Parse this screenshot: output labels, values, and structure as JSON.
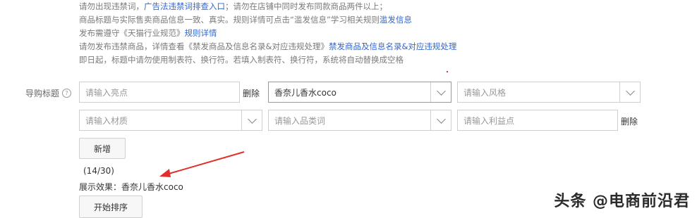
{
  "notes": {
    "line1": {
      "pre": "请勿出现违禁词，",
      "link": "广告法违禁词排查入口",
      "post": "；请勿在店铺中同时发布同款商品两件以上；"
    },
    "line2": {
      "pre": "商品标题与实际售卖商品信息一致、真实。规则详情可点击“滥发信息”学习相关规则",
      "link": "滥发信息"
    },
    "line3": {
      "pre": "发布需遵守《天猫行业规范》",
      "link": "规则详情"
    },
    "line4": {
      "pre": "请勿发布违禁商品，详情查看《禁发商品及信息名录&对应违规处理》",
      "link": "禁发商品及信息名录&对应违规处理"
    },
    "line5": {
      "text": "即日起，标题中请勿使用制表符、换行符。若填入制表符、换行符，系统将自动替换成空格"
    }
  },
  "form": {
    "label": "导购标题",
    "help_icon": "question-circle-icon",
    "fields": {
      "highlight": "请输入亮点",
      "brand_value": "香奈儿香水coco",
      "style": "请输入风格",
      "material": "请输入材质",
      "category": "请输入品类词",
      "benefit": "请输入利益点"
    },
    "delete_label": "删除",
    "add_button": "新增",
    "count": "(14/30)",
    "preview_label": "展示效果：",
    "preview_value": "香奈儿香水coco",
    "sort_button": "开始排序"
  },
  "watermark": "头条 @电商前沿君",
  "colors": {
    "link": "#3366cc",
    "arrow": "#e0302a"
  }
}
